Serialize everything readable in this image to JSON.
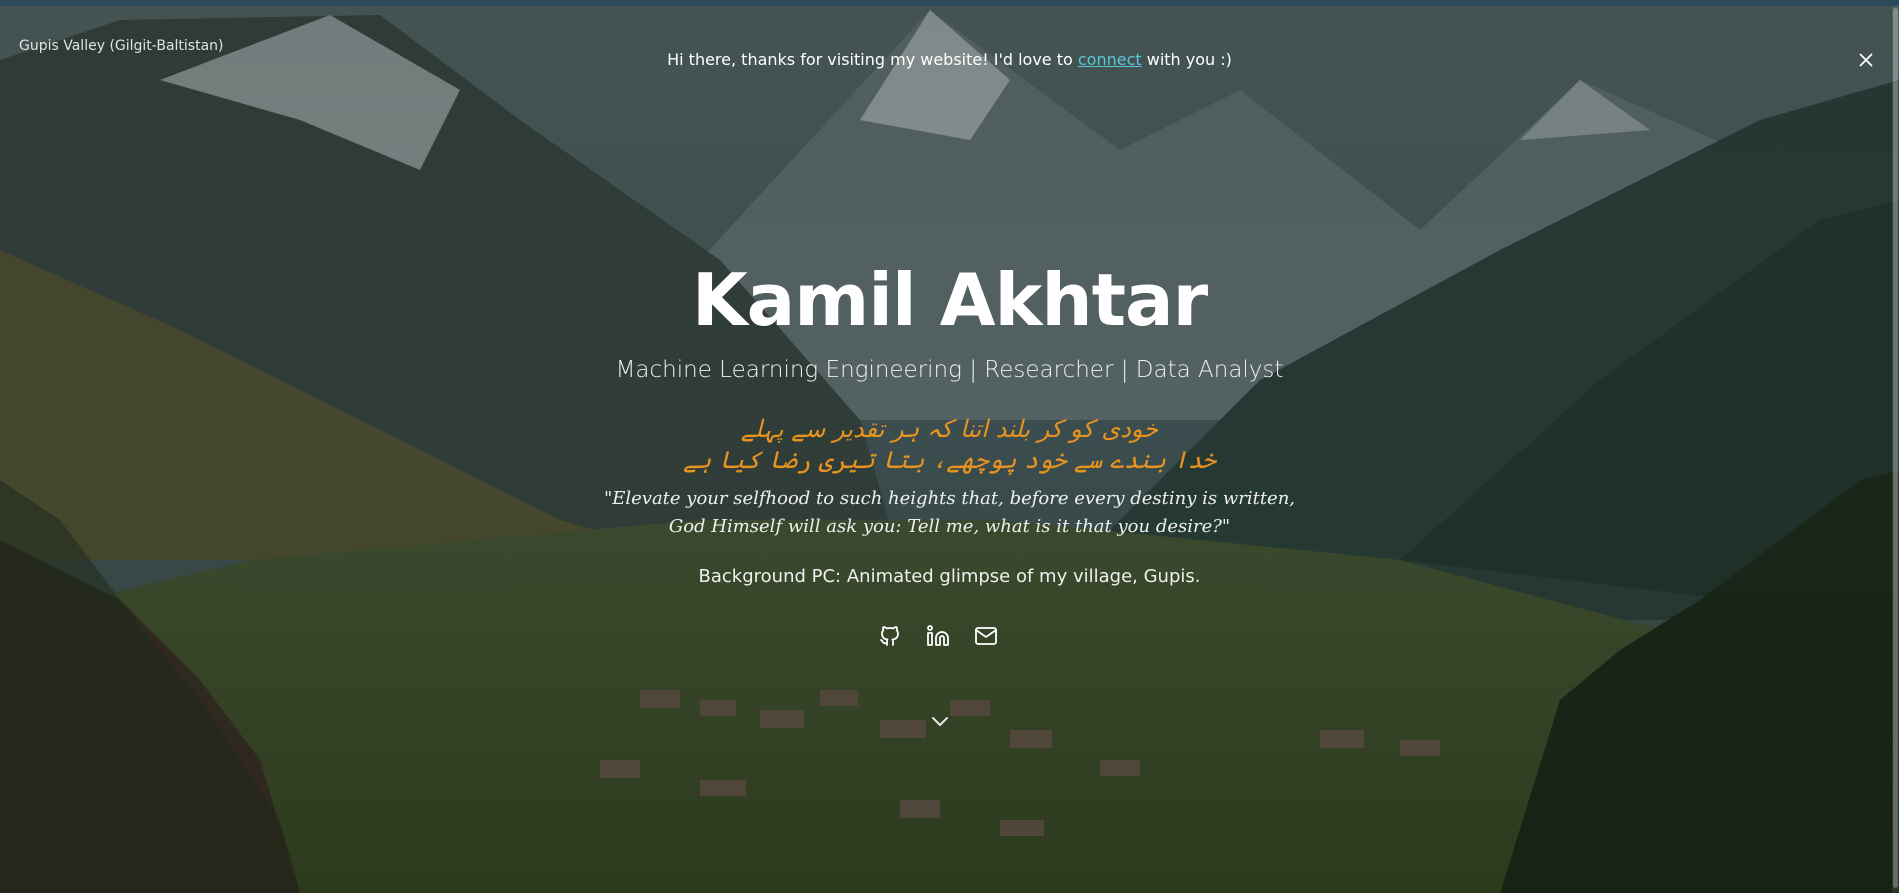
{
  "location_label": "Gupis Valley (Gilgit-Baltistan)",
  "banner": {
    "text_before": "Hi there, thanks for visiting my website! I'd love to ",
    "link_text": "connect",
    "text_after": " with you :)"
  },
  "hero": {
    "name": "Kamil Akhtar",
    "tagline": "Machine Learning Engineering | Researcher | Data Analyst",
    "urdu_line1": "خودی کو کر بلند اتنا کہ ہر تقدیر سے پہلے",
    "urdu_line2": "خدا بندے سے خود پوچھے، بتا تیری رضا کیا ہے",
    "translation_line1": "\"Elevate your selfhood to such heights that, before every destiny is written,",
    "translation_line2": "God Himself will ask you: Tell me, what is it that you desire?\"",
    "background_note": "Background PC: Animated glimpse of my village, Gupis."
  },
  "socials": [
    {
      "icon": "github-icon"
    },
    {
      "icon": "linkedin-icon"
    },
    {
      "icon": "email-icon"
    }
  ],
  "colors": {
    "accent_urdu": "#e9931f",
    "link": "#58c8d8",
    "overlay": "#1b2a2c"
  }
}
